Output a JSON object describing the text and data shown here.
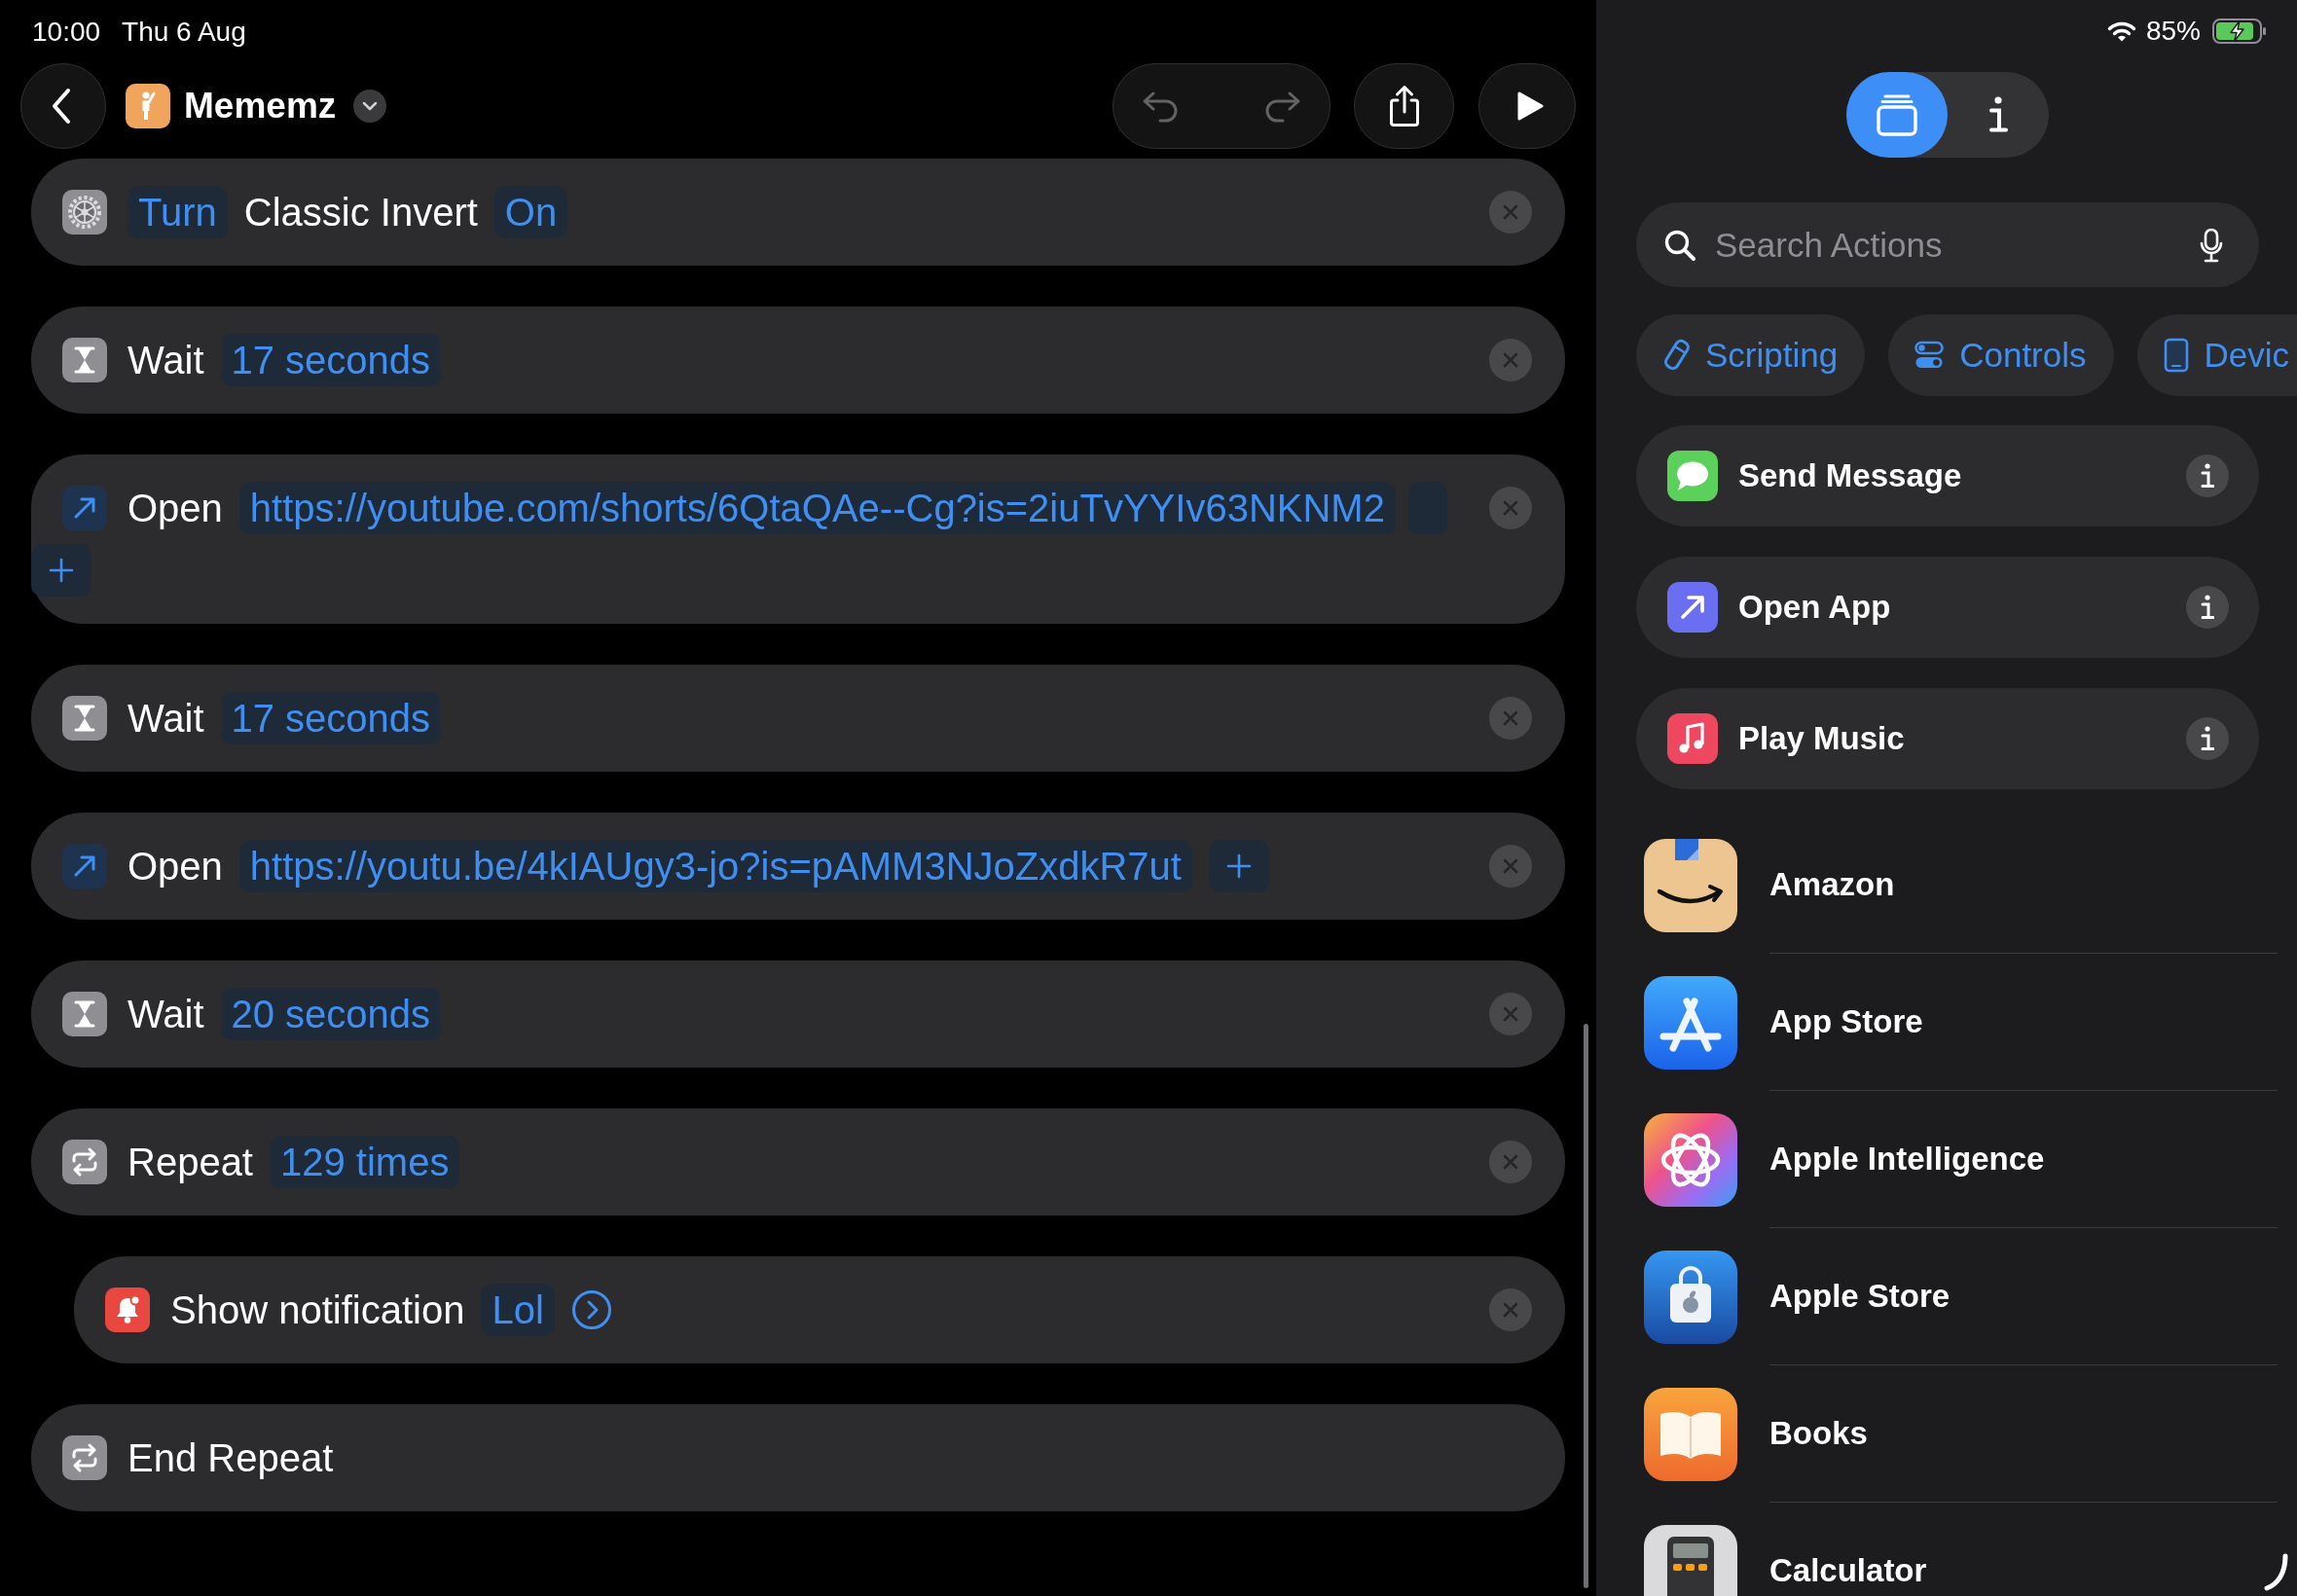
{
  "status_bar": {
    "time": "10:00",
    "date": "Thu 6 Aug",
    "battery": "85%"
  },
  "toolbar": {
    "title": "Mememz",
    "history": [
      {
        "kind": "undo",
        "disabled": true
      },
      {
        "kind": "redo",
        "disabled": true
      }
    ]
  },
  "actions": [
    {
      "kind": "settings",
      "removable": true,
      "lines": [
        [
          {
            "kind": "token",
            "text": "Turn"
          },
          {
            "kind": "label",
            "text": "Classic Invert"
          },
          {
            "kind": "token",
            "text": "On"
          }
        ]
      ]
    },
    {
      "kind": "wait",
      "removable": true,
      "lines": [
        [
          {
            "kind": "label",
            "text": "Wait"
          },
          {
            "kind": "token",
            "text": "17 seconds"
          }
        ]
      ]
    },
    {
      "kind": "open",
      "removable": true,
      "lines": [
        [
          {
            "kind": "label",
            "text": "Open"
          },
          {
            "kind": "token",
            "text": "https://youtube.com/shorts/6QtaQAe--Cg?is=2iuTvYYIv63NKNM2"
          },
          {
            "kind": "fragment"
          }
        ],
        [
          {
            "kind": "add"
          }
        ]
      ]
    },
    {
      "kind": "wait",
      "removable": true,
      "lines": [
        [
          {
            "kind": "label",
            "text": "Wait"
          },
          {
            "kind": "token",
            "text": "17 seconds"
          }
        ]
      ]
    },
    {
      "kind": "open",
      "removable": true,
      "lines": [
        [
          {
            "kind": "label",
            "text": "Open"
          },
          {
            "kind": "token",
            "text": "https://youtu.be/4kIAUgy3-jo?is=pAMM3NJoZxdkR7ut"
          },
          {
            "kind": "add"
          }
        ]
      ]
    },
    {
      "kind": "wait",
      "removable": true,
      "lines": [
        [
          {
            "kind": "label",
            "text": "Wait"
          },
          {
            "kind": "token",
            "text": "20 seconds"
          }
        ]
      ]
    },
    {
      "kind": "repeat",
      "removable": true,
      "lines": [
        [
          {
            "kind": "label",
            "text": "Repeat"
          },
          {
            "kind": "token",
            "text": "129 times"
          }
        ]
      ],
      "children": [
        {
          "kind": "notification",
          "removable": true,
          "lines": [
            [
              {
                "kind": "label",
                "text": "Show notification"
              },
              {
                "kind": "token",
                "text": "Lol"
              },
              {
                "kind": "more"
              }
            ]
          ]
        }
      ]
    },
    {
      "kind": "repeat",
      "removable": false,
      "lines": [
        [
          {
            "kind": "label",
            "text": "End Repeat"
          }
        ]
      ]
    }
  ],
  "view_switch": [
    {
      "kind": "library",
      "selected": true
    },
    {
      "kind": "info",
      "selected": false
    }
  ],
  "search": {
    "placeholder": "Search Actions"
  },
  "categories": [
    {
      "kind": "scripting",
      "label": "Scripting"
    },
    {
      "kind": "controls",
      "label": "Controls"
    },
    {
      "kind": "device",
      "label": "Devic"
    }
  ],
  "suggested_actions": [
    {
      "kind": "message",
      "label": "Send Message"
    },
    {
      "kind": "open_app",
      "label": "Open App"
    },
    {
      "kind": "music",
      "label": "Play Music"
    }
  ],
  "apps": [
    {
      "kind": "amazon",
      "name": "Amazon"
    },
    {
      "kind": "app_store",
      "name": "App Store"
    },
    {
      "kind": "intelligence",
      "name": "Apple Intelligence"
    },
    {
      "kind": "apple_store",
      "name": "Apple Store"
    },
    {
      "kind": "books",
      "name": "Books"
    },
    {
      "kind": "calculator",
      "name": "Calculator"
    }
  ]
}
